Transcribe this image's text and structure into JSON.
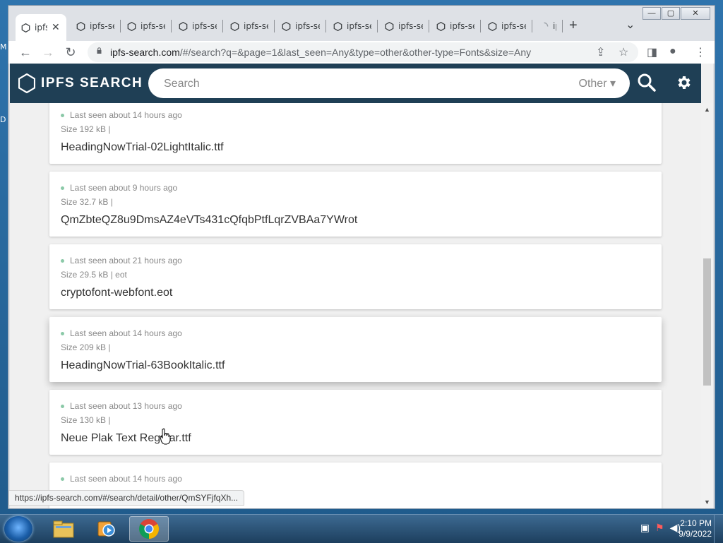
{
  "desktop": {
    "left_letters": [
      "M",
      "D"
    ]
  },
  "browser": {
    "tabs": [
      {
        "title": "ipfs",
        "active": true
      },
      {
        "title": "ipfs-se"
      },
      {
        "title": "ipfs-se"
      },
      {
        "title": "ipfs-se"
      },
      {
        "title": "ipfs-se"
      },
      {
        "title": "ipfs-se"
      },
      {
        "title": "ipfs-se"
      },
      {
        "title": "ipfs-se"
      },
      {
        "title": "ipfs-se"
      },
      {
        "title": "ipfs-se"
      },
      {
        "title": "ip"
      }
    ],
    "tab_close": "✕",
    "new_tab": "+",
    "tab_menu": "⌄",
    "window_buttons": {
      "minimize": "—",
      "maximize": "▢",
      "close": "✕"
    },
    "address": {
      "host": "ipfs-search.com",
      "path": "/#/search?q=&page=1&last_seen=Any&type=other&other-type=Fonts&size=Any"
    },
    "status_url": "https://ipfs-search.com/#/search/detail/other/QmSYFjfqXh..."
  },
  "app": {
    "logo_text": "IPFS SEARCH",
    "search_placeholder": "Search",
    "type_selected": "Other",
    "results": [
      {
        "last_seen": "Last seen about 14 hours ago",
        "size": "Size 192 kB |",
        "name": "HeadingNowTrial-02LightItalic.ttf"
      },
      {
        "last_seen": "Last seen about 9 hours ago",
        "size": "Size 32.7 kB |",
        "name": "QmZbteQZ8u9DmsAZ4eVTs431cQfqbPtfLqrZVBAa7YWrot"
      },
      {
        "last_seen": "Last seen about 21 hours ago",
        "size": "Size 29.5 kB | eot",
        "name": "cryptofont-webfont.eot"
      },
      {
        "last_seen": "Last seen about 14 hours ago",
        "size": "Size 209 kB |",
        "name": "HeadingNowTrial-63BookItalic.ttf",
        "hovered": true
      },
      {
        "last_seen": "Last seen about 13 hours ago",
        "size": "Size 130 kB |",
        "name": "Neue Plak Text Regular.ttf"
      },
      {
        "last_seen": "Last seen about 14 hours ago",
        "size": "",
        "name": ""
      }
    ]
  },
  "taskbar": {
    "apps": [
      "explorer",
      "media-player",
      "chrome"
    ],
    "time": "2:10 PM",
    "date": "9/9/2022"
  },
  "colors": {
    "appbar": "#1f3f55",
    "card_bg": "#ffffff",
    "seen_dot": "#8bc9a8"
  }
}
